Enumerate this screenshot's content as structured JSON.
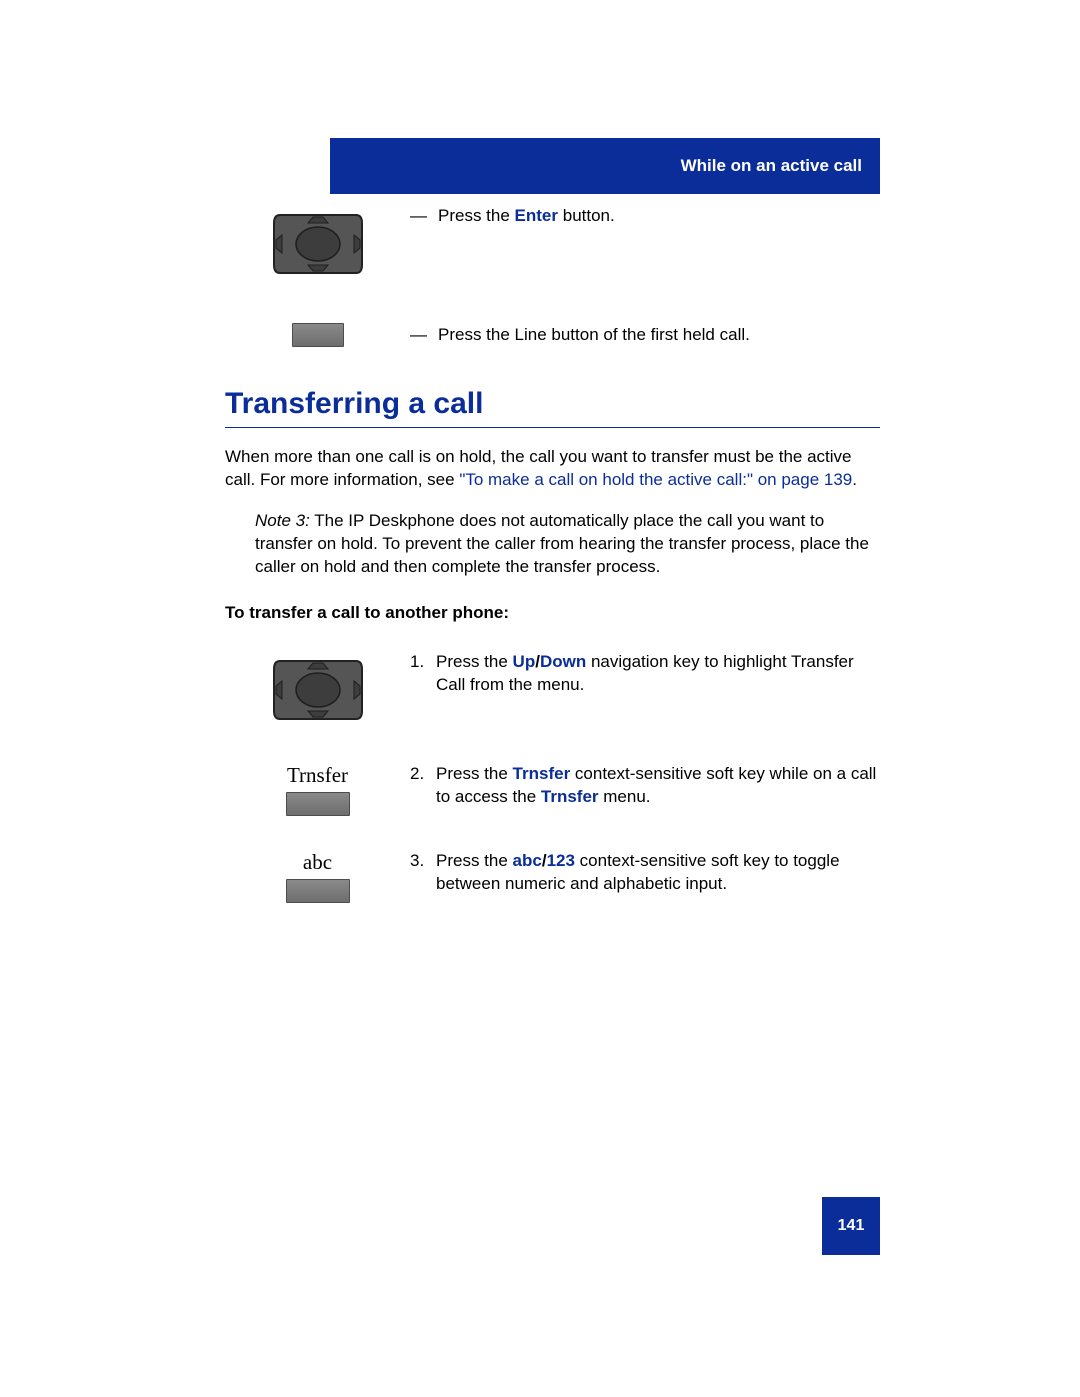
{
  "header": {
    "title": "While on an active call"
  },
  "intro_rows": [
    {
      "icon": "navkey",
      "dash": "—",
      "text_pre": "Press the ",
      "bold_blue": "Enter",
      "text_post": " button."
    },
    {
      "icon": "line-button",
      "dash": "—",
      "text_pre": "Press the Line button of the first held call.",
      "bold_blue": "",
      "text_post": ""
    }
  ],
  "section_heading": "Transferring a call",
  "para": {
    "pre": "When more than one call is on hold, the call you want to transfer must be the active call. For more information, see ",
    "link": "\"To make a call on hold the active call:\" on page 139",
    "post": "."
  },
  "note": {
    "label": "Note 3:",
    "text": "  The IP Deskphone does not automatically place the call you want to transfer on hold. To prevent the caller from hearing the transfer process, place the caller on hold and then complete the transfer process."
  },
  "subhead": "To transfer a call to another phone:",
  "steps": [
    {
      "icon": "navkey",
      "softkey_label": "",
      "num": "1.",
      "parts": [
        {
          "t": "Press the ",
          "c": ""
        },
        {
          "t": "Up",
          "c": "bold-blue"
        },
        {
          "t": "/",
          "c": "bold"
        },
        {
          "t": "Down",
          "c": "bold-blue"
        },
        {
          "t": " navigation key to highlight Transfer Call from the menu.",
          "c": ""
        }
      ]
    },
    {
      "icon": "softkey",
      "softkey_label": "Trnsfer",
      "num": "2.",
      "parts": [
        {
          "t": "Press the ",
          "c": ""
        },
        {
          "t": "Trnsfer",
          "c": "bold-blue"
        },
        {
          "t": " context-sensitive soft key while on a call to access the ",
          "c": ""
        },
        {
          "t": "Trnsfer",
          "c": "bold-blue"
        },
        {
          "t": " menu.",
          "c": ""
        }
      ]
    },
    {
      "icon": "softkey",
      "softkey_label": "abc",
      "num": "3.",
      "parts": [
        {
          "t": "Press the ",
          "c": ""
        },
        {
          "t": "abc",
          "c": "bold-blue"
        },
        {
          "t": "/",
          "c": "bold"
        },
        {
          "t": "123",
          "c": "bold-blue"
        },
        {
          "t": " context-sensitive soft key to toggle between numeric and alphabetic input.",
          "c": ""
        }
      ]
    }
  ],
  "page_number": "141"
}
